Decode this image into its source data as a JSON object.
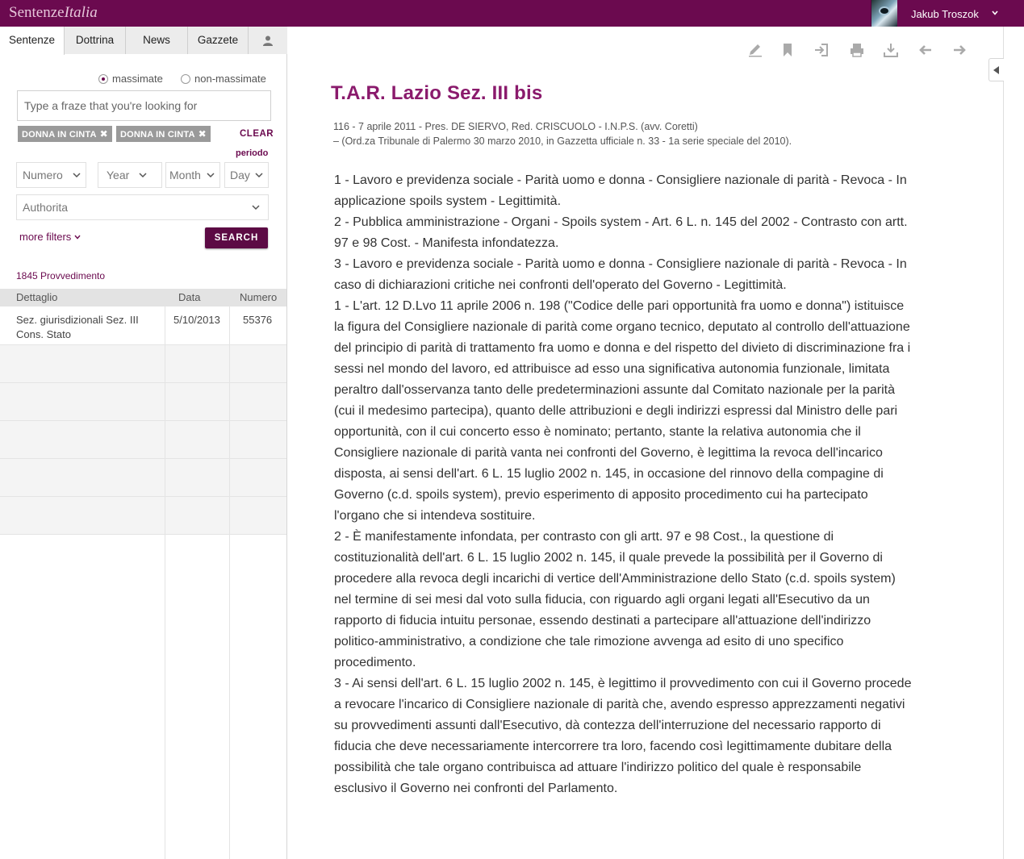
{
  "app": {
    "logo_part1": "Sentenze",
    "logo_part2": "Italia",
    "user_name": "Jakub Troszok"
  },
  "tabs": [
    {
      "label": "Sentenze",
      "active": true
    },
    {
      "label": "Dottrina",
      "active": false
    },
    {
      "label": "News",
      "active": false
    },
    {
      "label": "Gazzete",
      "active": false
    },
    {
      "label": "",
      "icon": "user-icon",
      "active": false
    }
  ],
  "filters": {
    "radio_massimate": "massimate",
    "radio_non_massimate": "non-massimate",
    "selected": "massimate",
    "search_placeholder": "Type a fraze that you're looking for",
    "chips": [
      "DONNA IN CINTA",
      "DONNA IN CINTA"
    ],
    "clear_label": "CLEAR",
    "periodo_label": "periodo",
    "numero_label": "Numero",
    "year_label": "Year",
    "month_label": "Month",
    "day_label": "Day",
    "authorita_label": "Authorita",
    "more_filters_label": "more filters",
    "search_button": "SEARCH"
  },
  "results": {
    "count_label": "1845 Provvedimento",
    "columns": [
      "Dettaglio",
      "Data",
      "Numero"
    ],
    "rows": [
      {
        "dettaglio_line1": "Sez. giurisdizionali Sez. III",
        "dettaglio_line2": "Cons. Stato",
        "data": "5/10/2013",
        "numero": "55376"
      }
    ]
  },
  "toolbar_icons": [
    "pencil-icon",
    "bookmark-icon",
    "login-icon",
    "print-icon",
    "download-icon",
    "arrow-left-icon",
    "arrow-right-icon"
  ],
  "document": {
    "title": "T.A.R. Lazio Sez. III bis",
    "meta_line1": "116 - 7 aprile 2011 - Pres. DE SIERVO, Red. CRISCUOLO - I.N.P.S. (avv. Coretti)",
    "meta_line2": "– (Ord.za Tribunale di Palermo 30 marzo 2010, in Gazzetta ufficiale n. 33 - 1a serie speciale del 2010).",
    "paragraphs": [
      "1 - Lavoro e previdenza sociale - Parità uomo e donna - Consigliere nazionale di parità - Revoca - In applicazione spoils system - Legittimità.",
      "2 - Pubblica amministrazione - Organi - Spoils system - Art. 6 L. n. 145 del 2002 - Contrasto con artt. 97 e 98 Cost. - Manifesta infondatezza.",
      "3 - Lavoro e previdenza sociale - Parità uomo e donna - Consigliere nazionale di parità - Revoca - In caso di dichiarazioni critiche nei confronti dell'operato del Governo - Legittimità.",
      "1 - L'art. 12 D.Lvo 11 aprile 2006 n. 198 (\"Codice delle pari opportunità fra uomo e donna\") istituisce la figura del Consigliere nazionale di parità come organo tecnico, deputato al controllo dell'attuazione del principio di parità di trattamento fra uomo e donna e del rispetto del divieto di discriminazione fra i sessi nel mondo del lavoro, ed attribuisce ad esso una significativa autonomia funzionale, limitata peraltro dall'osservanza tanto delle predeterminazioni assunte dal Comitato nazionale per la parità (cui il medesimo partecipa), quanto delle attribuzioni e degli indirizzi espressi dal Ministro delle pari opportunità, con il cui concerto esso è nominato; pertanto, stante la relativa autonomia che il Consigliere nazionale di parità vanta nei confronti del Governo, è legittima la revoca dell'incarico disposta, ai sensi dell'art. 6 L. 15 luglio 2002 n. 145, in occasione del rinnovo della compagine di Governo (c.d. spoils system), previo esperimento di apposito procedimento cui ha partecipato l'organo che si intendeva sostituire.",
      "2 - È manifestamente infondata, per contrasto con gli artt. 97 e 98 Cost., la questione di costituzionalità dell'art. 6 L. 15 luglio 2002 n. 145, il quale prevede la possibilità per il Governo di procedere alla revoca degli incarichi di vertice dell'Amministrazione dello Stato (c.d. spoils system) nel termine di sei mesi dal voto sulla fiducia, con riguardo agli organi legati all'Esecutivo da un rapporto di fiducia intuitu personae, essendo destinati a partecipare all'attuazione dell'indirizzo politico-amministrativo, a condizione che tale rimozione avvenga ad esito di uno specifico procedimento.",
      "3 - Ai sensi dell'art. 6 L. 15 luglio 2002 n. 145, è legittimo il provvedimento con cui il Governo procede a revocare l'incarico di Consigliere nazionale di parità che, avendo espresso apprezzamenti negativi su provvedimenti assunti dall'Esecutivo, dà contezza dell'interruzione del necessario rapporto di fiducia che deve necessariamente intercorrere tra loro, facendo così legittimamente dubitare della possibilità che tale organo contribuisca ad attuare l'indirizzo politico del quale è responsabile esclusivo il Governo nei confronti del Parlamento."
    ]
  },
  "colors": {
    "brand": "#6b0a4f",
    "title": "#8a1a6c",
    "chip": "#9a9a9a",
    "button": "#5c0a44"
  }
}
